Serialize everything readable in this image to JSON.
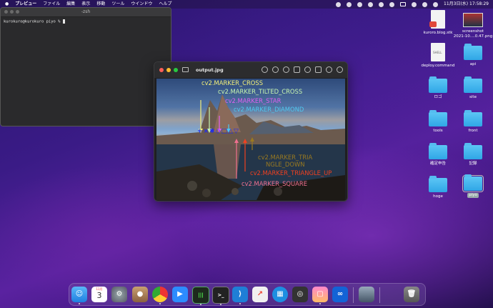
{
  "menubar": {
    "app_name": "プレビュー",
    "menus": [
      "ファイル",
      "編集",
      "表示",
      "移動",
      "ツール",
      "ウインドウ",
      "ヘルプ"
    ],
    "datetime": "11月3日(水)  17:58:29"
  },
  "terminal": {
    "title": "-zsh",
    "prompt": "kurokuro@kurokuro piyo % "
  },
  "preview": {
    "title": "output.jpg",
    "annotations": {
      "cross": "cv2.MARKER_CROSS",
      "tilted_cross": "cv2.MARKER_TILTED_CROSS",
      "star": "cv2.MARKER_STAR",
      "diamond": "cv2.MARKER_DIAMOND",
      "triangle_down_1": "cv2.MARKER_TRIA",
      "triangle_down_2": "NGLE_DOWN",
      "triangle_up": "cv2.MARKER_TRIANGLE_UP",
      "square": "cv2.MARKER_SQUARE"
    },
    "colors": {
      "cross": "#f3f07a",
      "tilted_cross": "#c8f7b0",
      "star": "#e060f0",
      "diamond": "#4ec8f0",
      "triangle_down": "#9a7a20",
      "triangle_up": "#f04020",
      "square": "#f07090"
    }
  },
  "desktop_icons": [
    {
      "label": "kuroro.blog.stk",
      "kind": "doc"
    },
    {
      "label": "screenshot\n2021-10....0.47.png",
      "kind": "shot"
    },
    {
      "label": "deploy.command",
      "kind": "shell"
    },
    {
      "label": "api",
      "kind": "folder"
    },
    {
      "label": "ロゴ",
      "kind": "folder"
    },
    {
      "label": "site",
      "kind": "folder"
    },
    {
      "label": "tools",
      "kind": "folder"
    },
    {
      "label": "front",
      "kind": "folder"
    },
    {
      "label": "確定申告",
      "kind": "folder"
    },
    {
      "label": "記録",
      "kind": "folder"
    },
    {
      "label": "hoge",
      "kind": "folder"
    },
    {
      "label": "piyo",
      "kind": "folder"
    }
  ],
  "dock": {
    "calendar_month": "11月",
    "calendar_day": "3"
  }
}
